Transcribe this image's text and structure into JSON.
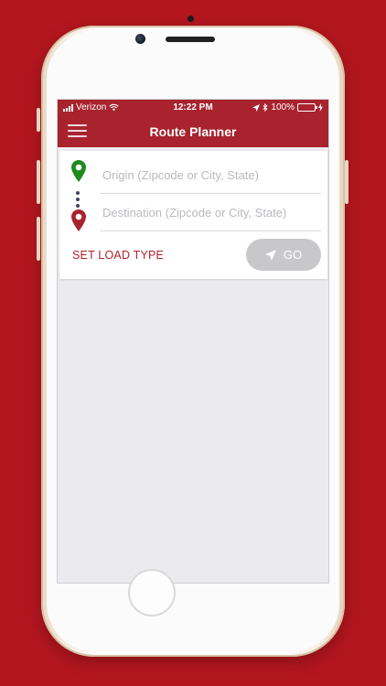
{
  "status_bar": {
    "carrier": "Verizon",
    "time": "12:22 PM",
    "battery_percent": "100%",
    "battery_level": 1.0
  },
  "nav": {
    "title": "Route Planner",
    "menu_icon": "hamburger-menu-icon"
  },
  "route_form": {
    "origin_placeholder": "Origin (Zipcode or City, State)",
    "destination_placeholder": "Destination (Zipcode or City, State)",
    "origin_pin_color": "#1f8a1f",
    "destination_pin_color": "#a8232d",
    "set_load_type_label": "SET LOAD TYPE",
    "go_label": "GO",
    "go_icon": "navigation-arrow-icon"
  },
  "colors": {
    "background": "#b4161f",
    "header": "#a8232d",
    "accent_text": "#b0222c",
    "go_button": "#c8c8cb",
    "content_bg": "#ebebee"
  }
}
